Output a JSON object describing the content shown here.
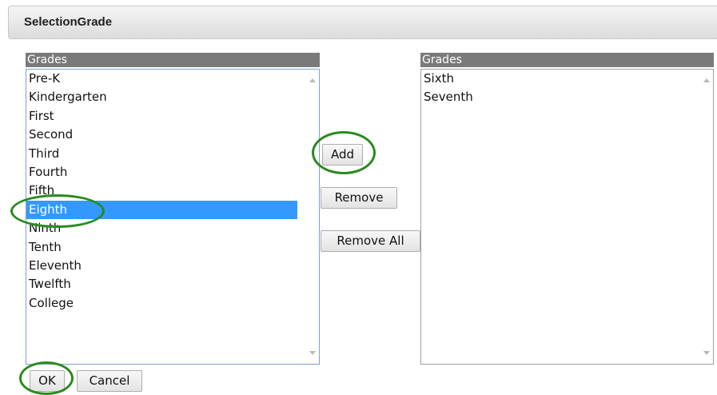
{
  "dialog": {
    "title": "SelectionGrade"
  },
  "available_list": {
    "header": "Grades",
    "items": [
      "Pre-K",
      "Kindergarten",
      "First",
      "Second",
      "Third",
      "Fourth",
      "Fifth",
      "Eighth",
      "Ninth",
      "Tenth",
      "Eleventh",
      "Twelfth",
      "College"
    ],
    "selected": "Eighth"
  },
  "selected_list": {
    "header": "Grades",
    "items": [
      "Sixth",
      "Seventh"
    ]
  },
  "buttons": {
    "add": "Add",
    "remove": "Remove",
    "remove_all": "Remove All",
    "ok": "OK",
    "cancel": "Cancel"
  },
  "annotations": {
    "color": "#2a8a1e"
  },
  "colors": {
    "selection": "#3399ff",
    "list_header": "#7a7a7a"
  }
}
